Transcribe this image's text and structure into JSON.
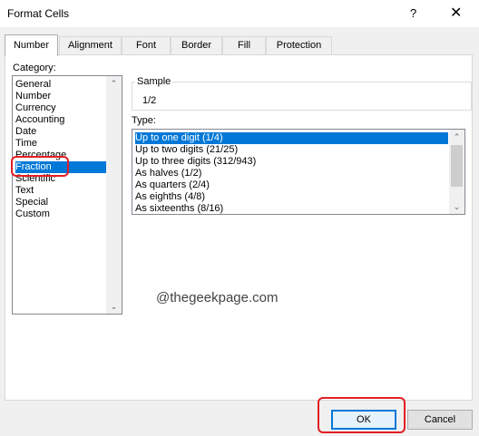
{
  "window": {
    "title": "Format Cells",
    "help_glyph": "?",
    "close_glyph": "✕"
  },
  "tabs": [
    {
      "label": "Number",
      "active": true
    },
    {
      "label": "Alignment",
      "active": false
    },
    {
      "label": "Font",
      "active": false
    },
    {
      "label": "Border",
      "active": false
    },
    {
      "label": "Fill",
      "active": false
    },
    {
      "label": "Protection",
      "active": false
    }
  ],
  "category": {
    "label": "Category:",
    "items": [
      "General",
      "Number",
      "Currency",
      "Accounting",
      "Date",
      "Time",
      "Percentage",
      "Fraction",
      "Scientific",
      "Text",
      "Special",
      "Custom"
    ],
    "selected": "Fraction"
  },
  "sample": {
    "label": "Sample",
    "value": "1/2"
  },
  "type": {
    "label": "Type:",
    "items": [
      "Up to one digit (1/4)",
      "Up to two digits (21/25)",
      "Up to three digits (312/943)",
      "As halves (1/2)",
      "As quarters (2/4)",
      "As eighths (4/8)",
      "As sixteenths (8/16)"
    ],
    "selected": "Up to one digit (1/4)"
  },
  "watermark": "@thegeekpage.com",
  "buttons": {
    "ok": "OK",
    "cancel": "Cancel"
  },
  "scroll_glyphs": {
    "up": "⌃",
    "down": "⌄"
  },
  "colors": {
    "selection": "#0078d7",
    "annotation": "#e31e24"
  }
}
